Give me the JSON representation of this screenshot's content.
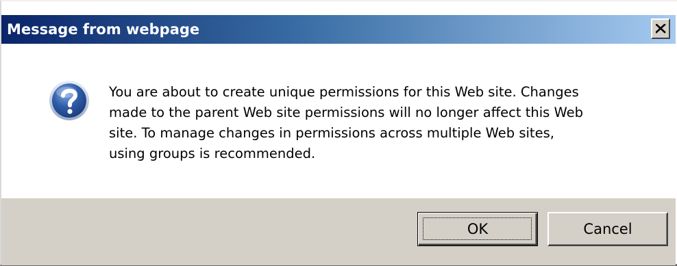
{
  "dialog": {
    "title": "Message from webpage",
    "close_symbol": "×",
    "icon": "question-icon",
    "message_lines": [
      "You are about to create unique permissions for this Web site. Changes",
      "made to the parent Web site permissions will no longer affect this Web",
      "site. To manage changes in permissions across multiple Web sites,",
      "using groups is recommended."
    ],
    "buttons": {
      "ok": "OK",
      "cancel": "Cancel"
    }
  },
  "colors": {
    "title_gradient_start": "#0a246a",
    "title_gradient_end": "#a6caf0",
    "button_bar": "#d4d0c8",
    "icon_blue": "#2f5da8"
  }
}
